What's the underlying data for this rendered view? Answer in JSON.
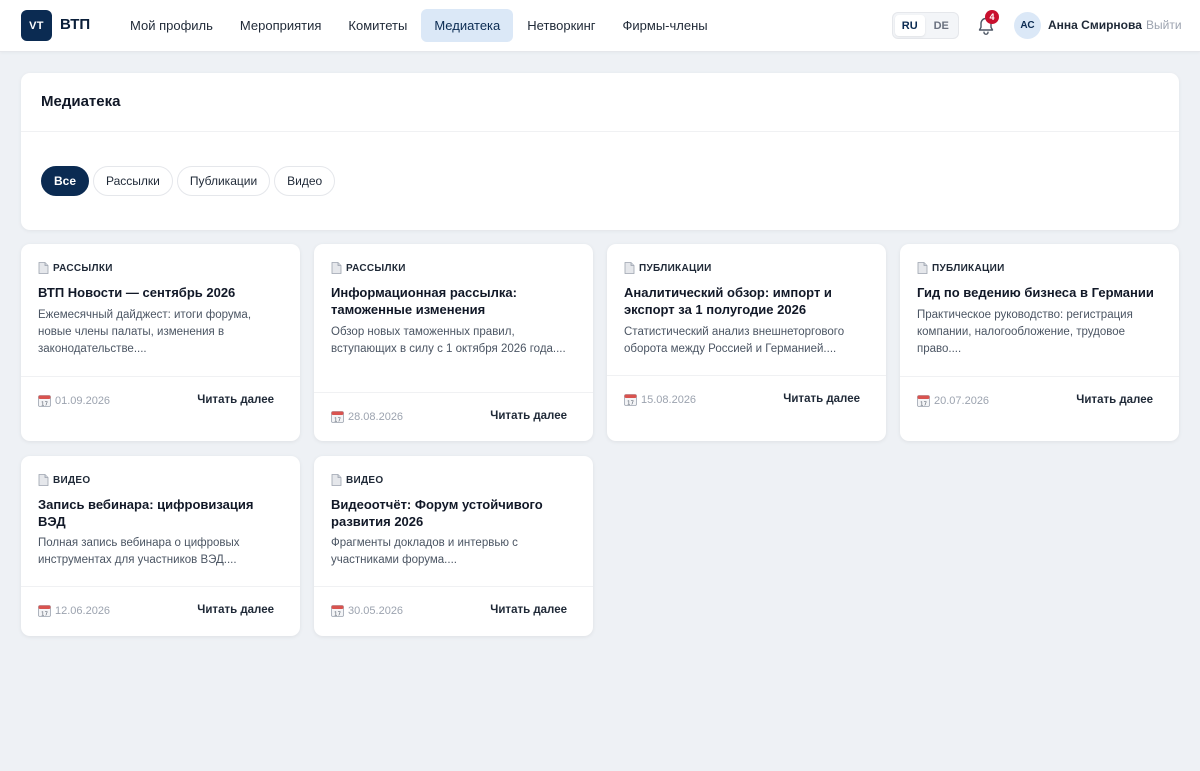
{
  "header": {
    "logo_badge": "VT",
    "logo_name": "ВТП",
    "nav": [
      "Мой профиль",
      "Мероприятия",
      "Комитеты",
      "Медиатека",
      "Нетворкинг",
      "Фирмы-члены"
    ],
    "nav_active_index": 3,
    "languages": [
      "RU",
      "DE"
    ],
    "language_active": "RU",
    "notifications_count": "4",
    "user_initials": "АС",
    "user_name": "Анна Смирнова",
    "logout_label": "Выйти"
  },
  "panel": {
    "title": "Медиатека",
    "filters": [
      "Все",
      "Рассылки",
      "Публикации",
      "Видео"
    ],
    "filter_active_index": 0
  },
  "cards": [
    {
      "category": "РАССЫЛКИ",
      "title": "ВТП Новости — сентябрь 2026",
      "description": "Ежемесячный дайджест: итоги форума, новые члены палаты, изменения в законодательстве....",
      "date": "01.09.2026",
      "link": "Читать далее"
    },
    {
      "category": "РАССЫЛКИ",
      "title": "Информационная рассылка: таможенные изменения",
      "description": "Обзор новых таможенных правил, вступающих в силу с 1 октября 2026 года....",
      "date": "28.08.2026",
      "link": "Читать далее"
    },
    {
      "category": "ПУБЛИКАЦИИ",
      "title": "Аналитический обзор: импорт и экспорт за 1 полугодие 2026",
      "description": "Статистический анализ внешнеторгового оборота между Россией и Германией....",
      "date": "15.08.2026",
      "link": "Читать далее"
    },
    {
      "category": "ПУБЛИКАЦИИ",
      "title": "Гид по ведению бизнеса в Германии",
      "description": "Практическое руководство: регистрация компании, налогообложение, трудовое право....",
      "date": "20.07.2026",
      "link": "Читать далее"
    },
    {
      "category": "ВИДЕО",
      "title": "Запись вебинара: цифровизация ВЭД",
      "description": "Полная запись вебинара о цифровых инструментах для участников ВЭД....",
      "date": "12.06.2026",
      "link": "Читать далее"
    },
    {
      "category": "ВИДЕО",
      "title": "Видеоотчёт: Форум устойчивого развития 2026",
      "description": "Фрагменты докладов и интервью с участниками форума....",
      "date": "30.05.2026",
      "link": "Читать далее"
    }
  ],
  "colors": {
    "brand": "#0b2b52",
    "accent_bg": "#dbe8f7",
    "badge": "#c8102e",
    "page_bg": "#eef1f5"
  },
  "icons": [
    "document-icon",
    "calendar-icon",
    "bell-icon"
  ]
}
